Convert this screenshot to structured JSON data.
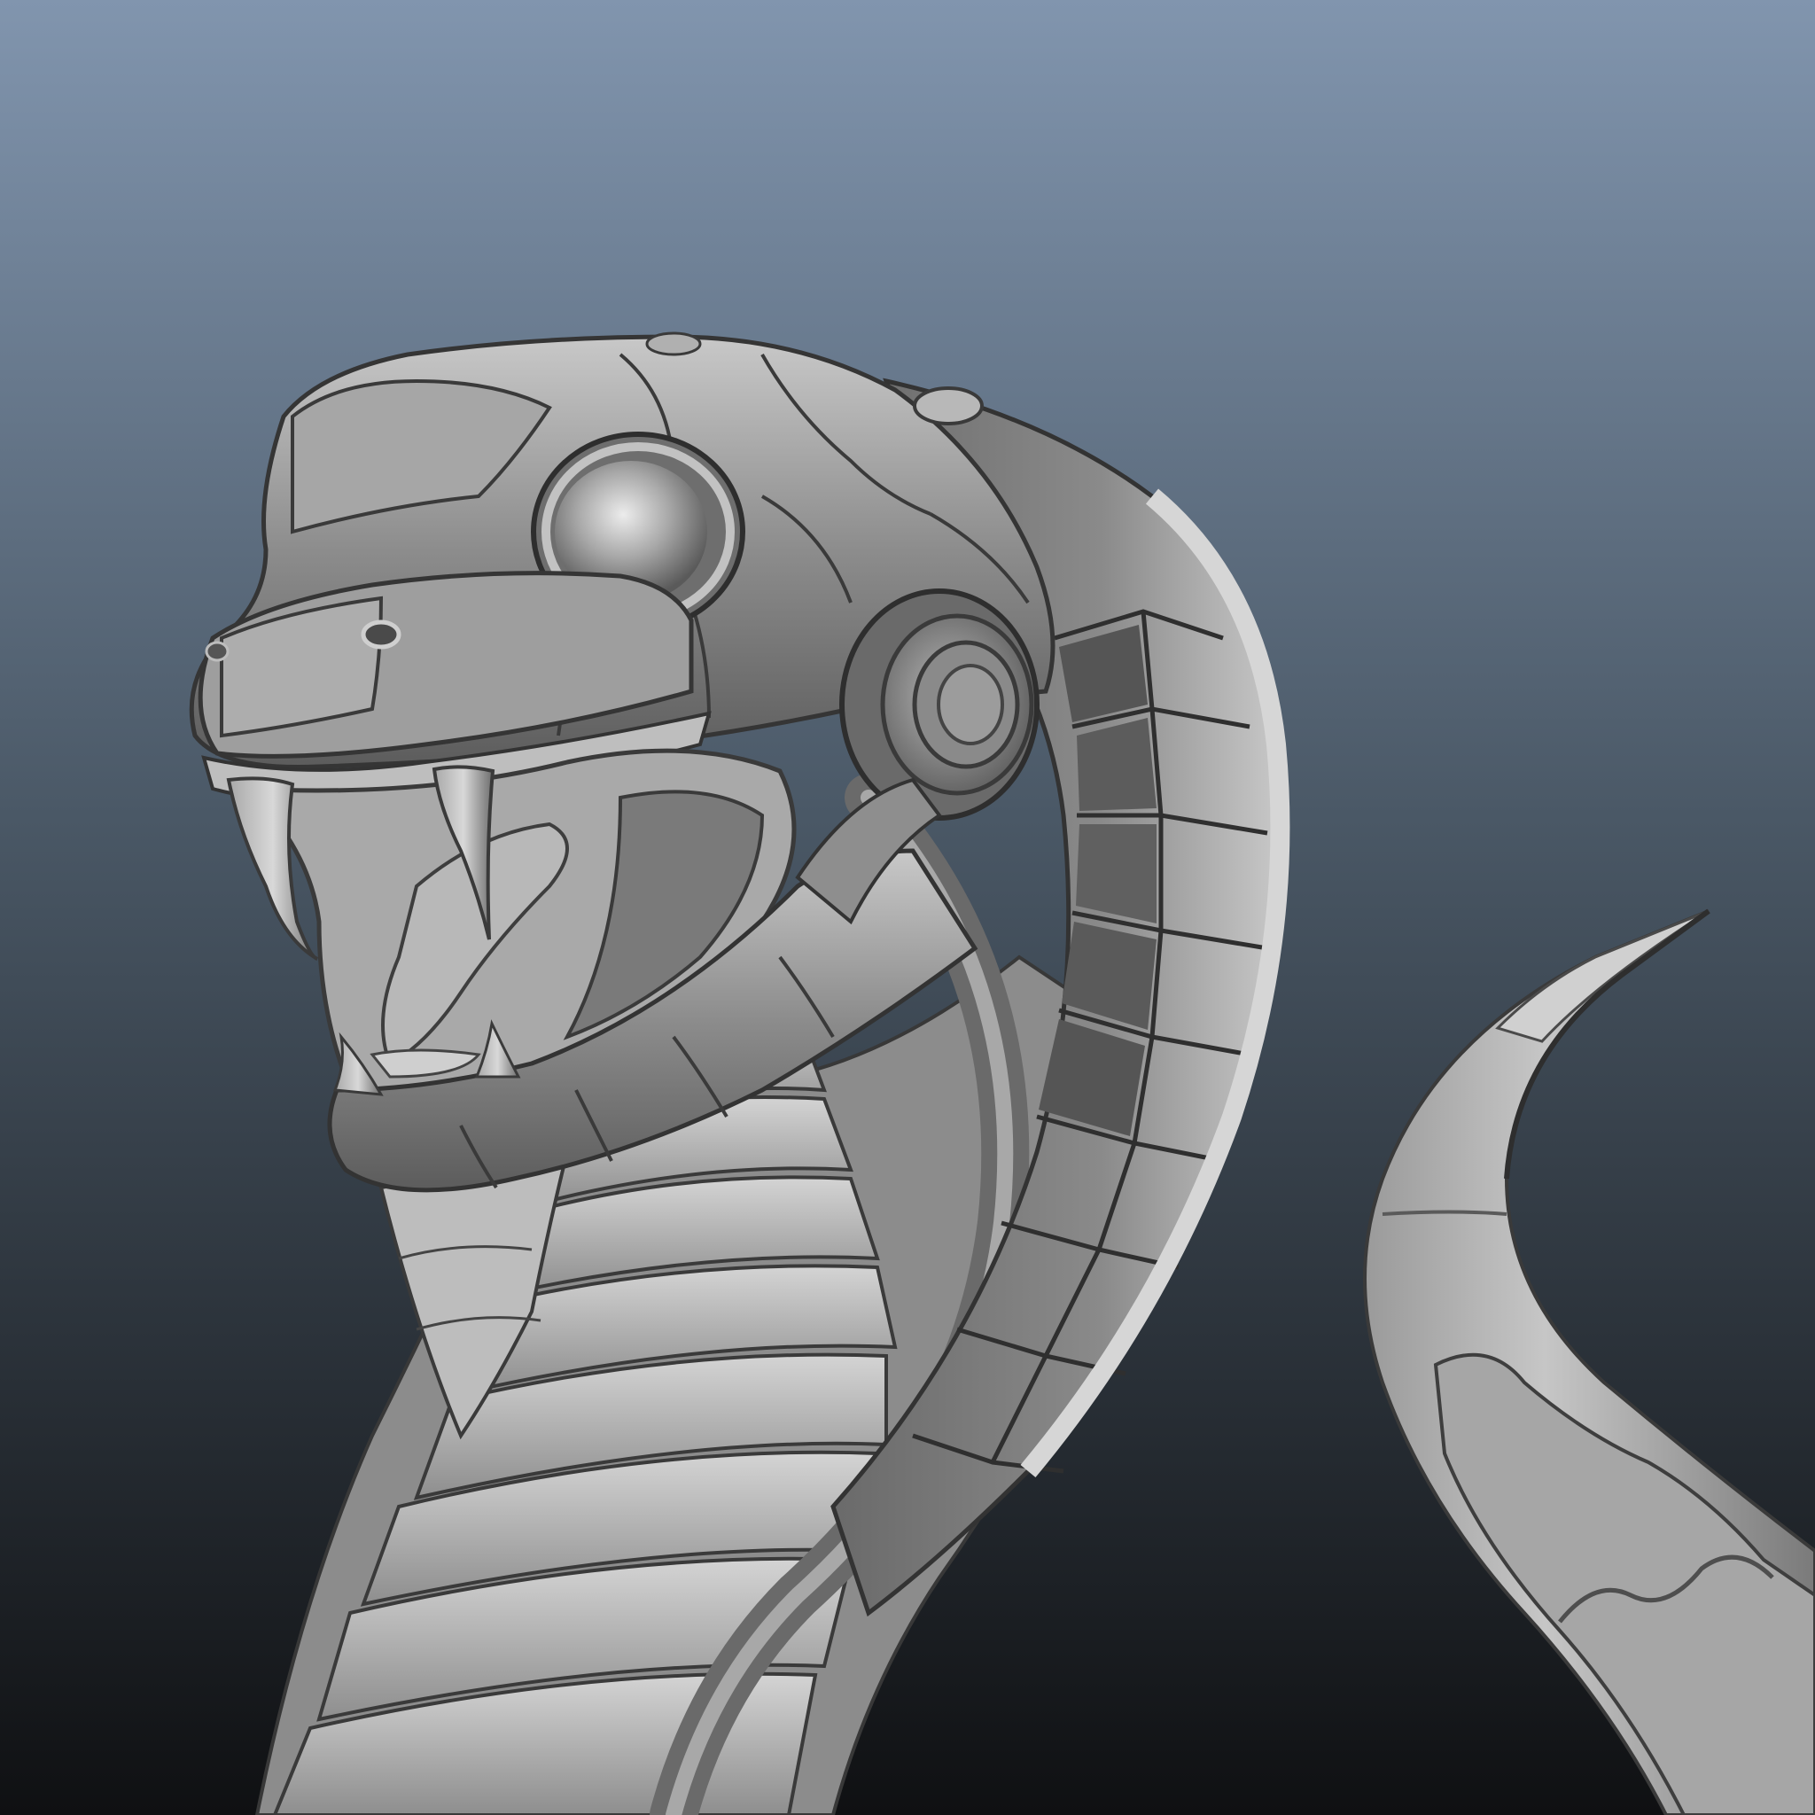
{
  "scene": {
    "subject": "robotic-cobra-sculpt",
    "background": {
      "gradient_top": "#8195ae",
      "gradient_mid": "#4a5866",
      "gradient_bottom": "#0f1012"
    },
    "material": {
      "base": "#8a8a8a",
      "light": "#c4c4c4",
      "highlight": "#e2e2e2",
      "mid": "#747474",
      "shadow": "#3a3a3a",
      "deep_shadow": "#1e1e1e"
    }
  }
}
